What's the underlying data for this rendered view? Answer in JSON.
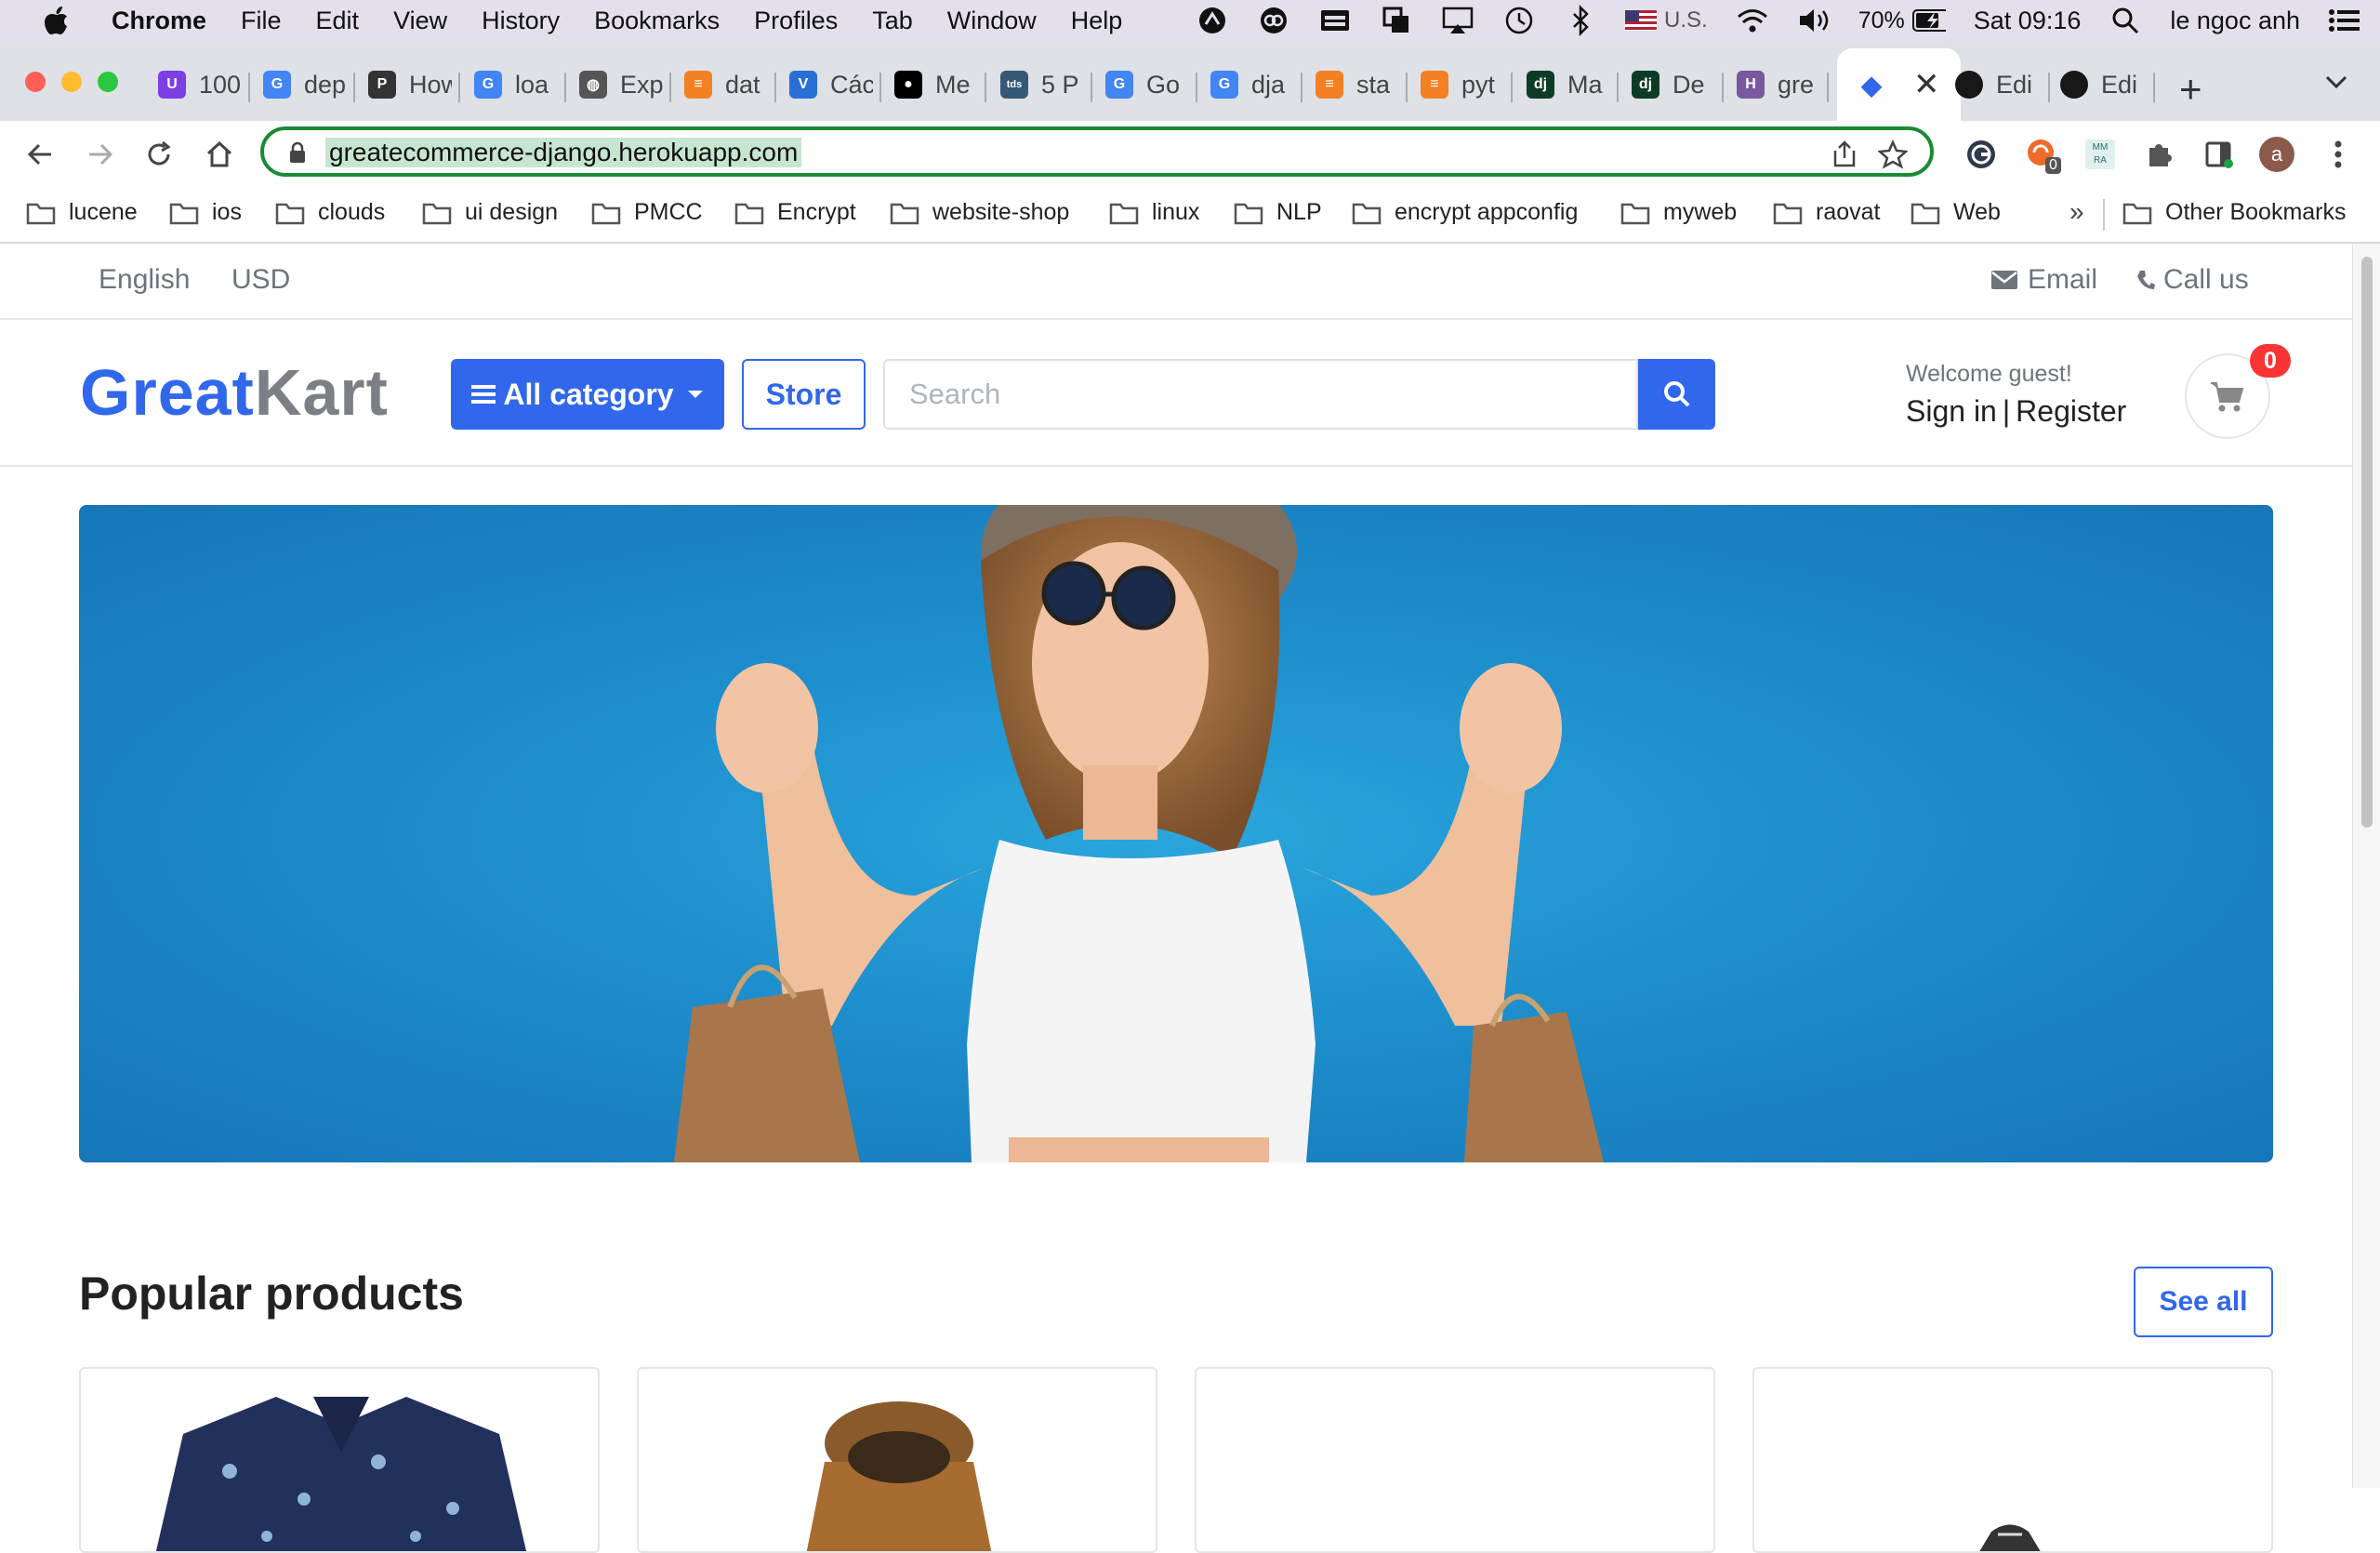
{
  "menubar": {
    "app": "Chrome",
    "items": [
      "File",
      "Edit",
      "View",
      "History",
      "Bookmarks",
      "Profiles",
      "Tab",
      "Window",
      "Help"
    ],
    "input_source": "U.S.",
    "battery": "70%",
    "clock": "Sat 09:16",
    "user": "le ngoc anh"
  },
  "tabs": [
    {
      "title": "100",
      "icon": "u-circle-icon",
      "color": "#7b3fe4"
    },
    {
      "title": "dep",
      "icon": "google-icon",
      "color": "#4285f4"
    },
    {
      "title": "How",
      "icon": "python-icon",
      "color": "#333333"
    },
    {
      "title": "loa",
      "icon": "google-icon",
      "color": "#4285f4"
    },
    {
      "title": "Exp",
      "icon": "globe-icon",
      "color": "#555555"
    },
    {
      "title": "dat",
      "icon": "stackoverflow-icon",
      "color": "#f48024"
    },
    {
      "title": "Các",
      "icon": "v-icon",
      "color": "#2a6fd6"
    },
    {
      "title": "Me",
      "icon": "medium-icon",
      "color": "#000000"
    },
    {
      "title": "5 P",
      "icon": "tds-icon",
      "color": "#355876"
    },
    {
      "title": "Go",
      "icon": "translate-icon",
      "color": "#4285f4"
    },
    {
      "title": "dja",
      "icon": "google-icon",
      "color": "#4285f4"
    },
    {
      "title": "sta",
      "icon": "stackoverflow-icon",
      "color": "#f48024"
    },
    {
      "title": "pyt",
      "icon": "stackoverflow-icon",
      "color": "#f48024"
    },
    {
      "title": "Ma",
      "icon": "django-icon",
      "color": "#0c3c26"
    },
    {
      "title": "De",
      "icon": "django-icon",
      "color": "#0c3c26"
    },
    {
      "title": "gre",
      "icon": "heroku-icon",
      "color": "#79589f"
    }
  ],
  "active_tab": {
    "title": "",
    "icon": "diamond-icon",
    "color": "#3167eb"
  },
  "tabs_after": [
    {
      "title": "Edi",
      "icon": "github-icon",
      "color": "#181717"
    },
    {
      "title": "Edi",
      "icon": "github-icon",
      "color": "#181717"
    }
  ],
  "omnibox": {
    "url": "greatecommerce-django.herokuapp.com"
  },
  "extension_badge": "0",
  "ext_mmra": "MM RA",
  "avatar_letter": "a",
  "bookmarks": [
    "lucene",
    "ios",
    "clouds",
    "ui design",
    "PMCC",
    "Encrypt",
    "website-shop",
    "linux",
    "NLP",
    "encrypt appconfig",
    "myweb",
    "raovat",
    "Web"
  ],
  "bookmarks_overflow": "»",
  "other_bookmarks": "Other Bookmarks",
  "site": {
    "topbar": {
      "language": "English",
      "currency": "USD",
      "email": "Email",
      "call": "Call us"
    },
    "logo": {
      "part1": "Great",
      "part2": "Kart"
    },
    "all_category": "All category",
    "store": "Store",
    "search_placeholder": "Search",
    "welcome": "Welcome guest!",
    "sign_in": "Sign in",
    "separator": "|",
    "register": "Register",
    "cart_count": "0",
    "popular_title": "Popular products",
    "see_all": "See all"
  },
  "colors": {
    "primary": "#3167eb",
    "badge": "#fa3434",
    "banner": "#1d8dcc",
    "omnibox_border": "#1a8a34"
  }
}
